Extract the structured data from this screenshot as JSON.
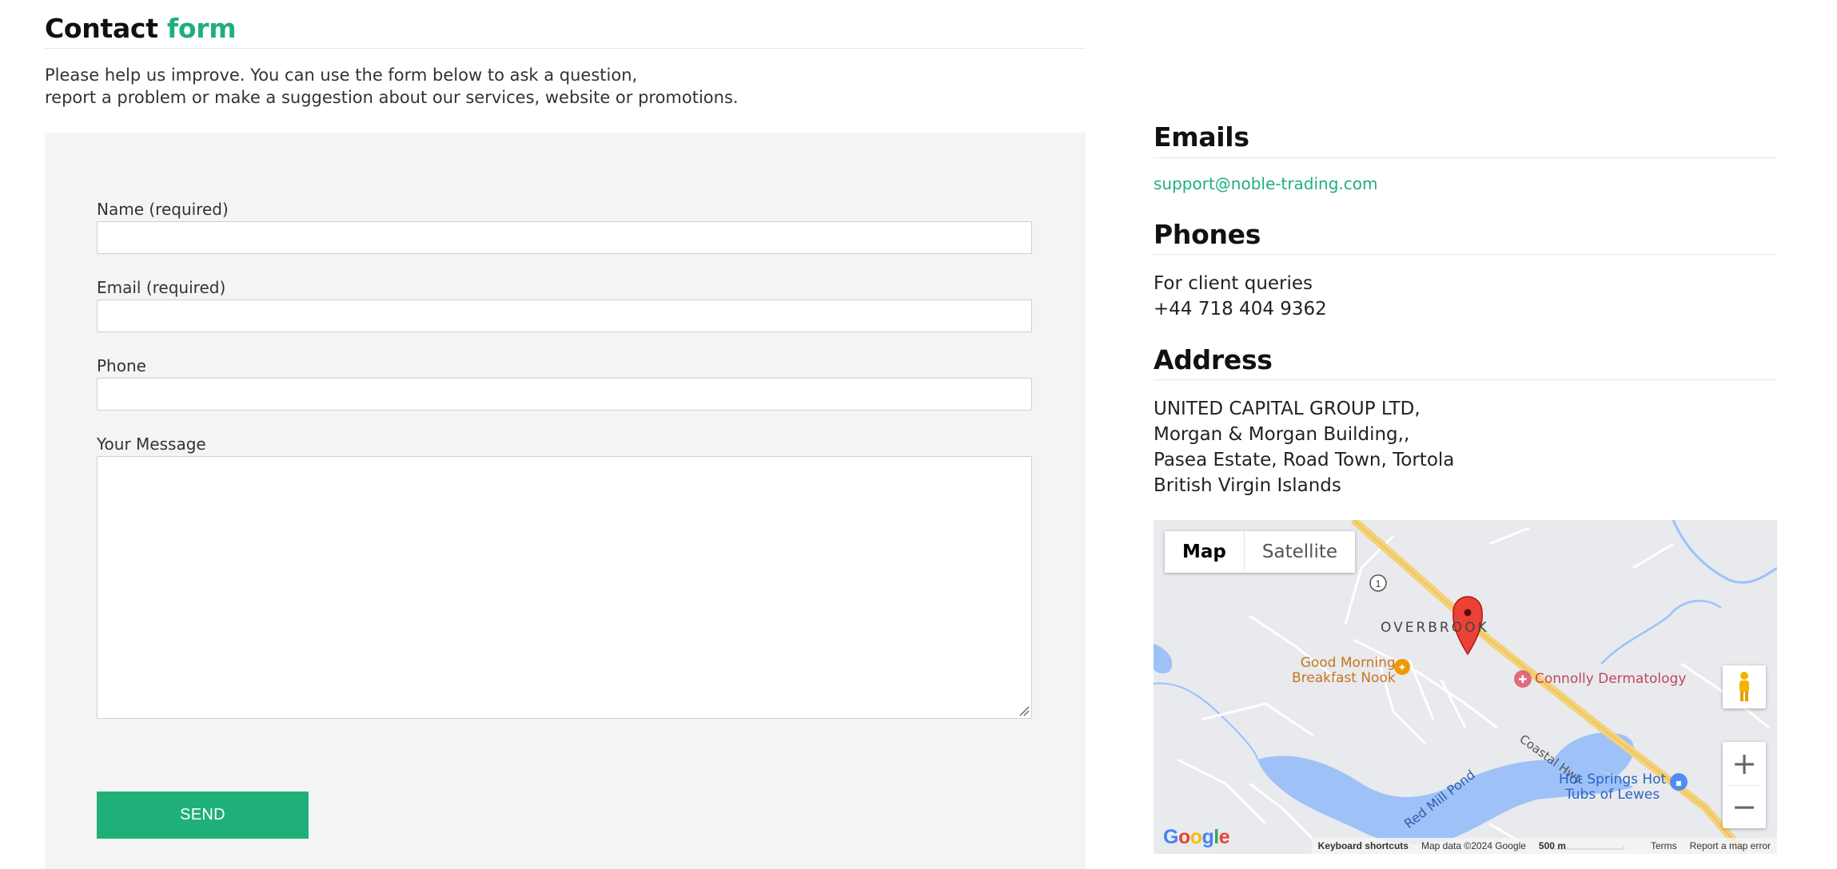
{
  "page": {
    "title_main": "Contact",
    "title_accent": "form",
    "intro_line1": "Please help us improve. You can use the form below to ask a question,",
    "intro_line2": "report a problem or make a suggestion about our services, website or promotions."
  },
  "form": {
    "name_label": "Name (required)",
    "name_value": "",
    "email_label": "Email (required)",
    "email_value": "",
    "phone_label": "Phone",
    "phone_value": "",
    "message_label": "Your Message",
    "message_value": "",
    "send_label": "SEND"
  },
  "sidebar": {
    "emails_heading": "Emails",
    "email": "support@noble-trading.com",
    "phones_heading": "Phones",
    "phone_caption": "For client queries",
    "phone_number": "+44 718 404 9362",
    "address_heading": "Address",
    "address_line1": "UNITED CAPITAL GROUP LTD,",
    "address_line2": "Morgan & Morgan Building,,",
    "address_line3": "Pasea Estate, Road Town, Tortola",
    "address_line4": "British Virgin Islands"
  },
  "map": {
    "type_map": "Map",
    "type_satellite": "Satellite",
    "route_shield": "1",
    "label_overbrook": "OVERBROOK",
    "label_breakfast_1": "Good Morning",
    "label_breakfast_2": "Breakfast Nook",
    "label_derm": "Connolly Dermatology",
    "label_highway": "Coastal Hwy",
    "label_pond": "Red Mill Pond",
    "label_springs_1": "Hot Springs Hot",
    "label_springs_2": "Tubs of Lewes",
    "google_logo": "Google",
    "footer_shortcuts": "Keyboard shortcuts",
    "footer_data": "Map data ©2024 Google",
    "footer_scale": "500 m",
    "footer_terms": "Terms",
    "footer_report": "Report a map error",
    "zoom_in": "+",
    "zoom_out": "−"
  },
  "colors": {
    "accent": "#1fb07a",
    "panel_bg": "#f4f4f4",
    "water": "#9ec1f8",
    "highway": "#f4d27a",
    "marker": "#ea4335"
  }
}
